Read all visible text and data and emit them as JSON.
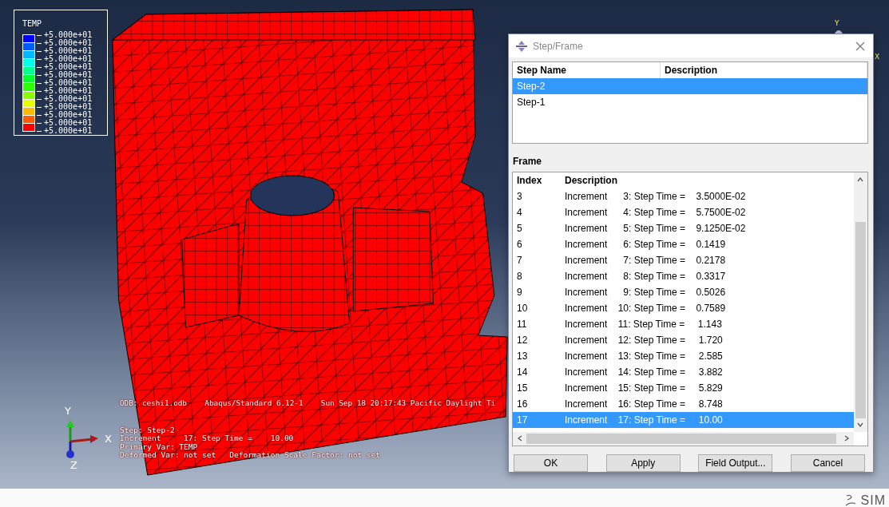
{
  "viewport": {
    "legend": {
      "title": "TEMP",
      "bands": [
        {
          "color": "#0000ff"
        },
        {
          "color": "#005cff"
        },
        {
          "color": "#00b8ff"
        },
        {
          "color": "#00ffe8"
        },
        {
          "color": "#00ff8c"
        },
        {
          "color": "#00ff2e"
        },
        {
          "color": "#2eff00"
        },
        {
          "color": "#8cff00"
        },
        {
          "color": "#e8ff00"
        },
        {
          "color": "#ffb800"
        },
        {
          "color": "#ff5c00"
        },
        {
          "color": "#ff0000"
        }
      ],
      "values": [
        "+5.000e+01",
        "+5.000e+01",
        "+5.000e+01",
        "+5.000e+01",
        "+5.000e+01",
        "+5.000e+01",
        "+5.000e+01",
        "+5.000e+01",
        "+5.000e+01",
        "+5.000e+01",
        "+5.000e+01",
        "+5.000e+01",
        "+5.000e+01"
      ]
    },
    "header_line": "ODB: ceshi1.odb    Abaqus/Standard 6.12-1    Sun Sep 18 20:17:43 Pacific Daylight Ti",
    "info_lines": [
      "Step: Step-2",
      "Increment     17: Step Time =    10.00",
      "Primary Var: TEMP",
      "Deformed Var: not set   Deformation Scale Factor: not set"
    ],
    "triad": {
      "y": "Y",
      "x": "X",
      "z": "Z"
    },
    "mini_triad": {
      "y": "Y",
      "x": "X"
    }
  },
  "dialog": {
    "title": "Step/Frame",
    "steps": {
      "columns": [
        "Step Name",
        "Description"
      ],
      "rows": [
        {
          "name": "Step-2",
          "selected": true
        },
        {
          "name": "Step-1",
          "selected": false
        }
      ]
    },
    "frame_label": "Frame",
    "frames": {
      "columns": [
        "Index",
        "Description"
      ],
      "rows": [
        {
          "index": "3",
          "description": "Increment      3: Step Time =    3.5000E-02",
          "selected": false
        },
        {
          "index": "4",
          "description": "Increment      4: Step Time =    5.7500E-02",
          "selected": false
        },
        {
          "index": "5",
          "description": "Increment      5: Step Time =    9.1250E-02",
          "selected": false
        },
        {
          "index": "6",
          "description": "Increment      6: Step Time =    0.1419",
          "selected": false
        },
        {
          "index": "7",
          "description": "Increment      7: Step Time =    0.2178",
          "selected": false
        },
        {
          "index": "8",
          "description": "Increment      8: Step Time =    0.3317",
          "selected": false
        },
        {
          "index": "9",
          "description": "Increment      9: Step Time =    0.5026",
          "selected": false
        },
        {
          "index": "10",
          "description": "Increment    10: Step Time =    0.7589",
          "selected": false
        },
        {
          "index": "11",
          "description": "Increment    11: Step Time =     1.143",
          "selected": false
        },
        {
          "index": "12",
          "description": "Increment    12: Step Time =     1.720",
          "selected": false
        },
        {
          "index": "13",
          "description": "Increment    13: Step Time =     2.585",
          "selected": false
        },
        {
          "index": "14",
          "description": "Increment    14: Step Time =     3.882",
          "selected": false
        },
        {
          "index": "15",
          "description": "Increment    15: Step Time =     5.829",
          "selected": false
        },
        {
          "index": "16",
          "description": "Increment    16: Step Time =     8.748",
          "selected": false
        },
        {
          "index": "17",
          "description": "Increment    17: Step Time =     10.00",
          "selected": true
        }
      ]
    },
    "buttons": [
      "OK",
      "Apply",
      "Field Output...",
      "Cancel"
    ]
  },
  "footer": {
    "logo": "SIM"
  }
}
